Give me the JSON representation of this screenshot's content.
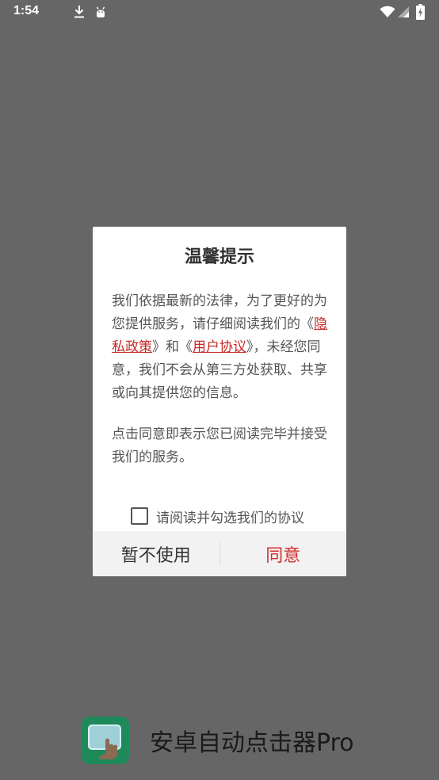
{
  "status_bar": {
    "time": "1:54"
  },
  "dialog": {
    "title": "温馨提示",
    "paragraph1": {
      "text_before": "我们依据最新的法律，为了更好的为您提供服务，请仔细阅读我们的《",
      "privacy_link": "隐私政策",
      "text_middle": "》和《",
      "user_agreement_link": "用户协议",
      "text_after": "》，未经您同意，我们不会从第三方处获取、共享或向其提供您的信息。"
    },
    "paragraph2": "点击同意即表示您已阅读完毕并接受我们的服务。",
    "agree_checkbox": {
      "label": "请阅读并勾选我们的协议",
      "checked": false
    },
    "buttons": {
      "decline": "暂不使用",
      "agree": "同意"
    }
  },
  "app": {
    "name": "安卓自动点击器Pro"
  },
  "colors": {
    "background": "#666666",
    "link": "#c62828",
    "agree_button": "#d32f2f",
    "button_bar": "#f2f2f2",
    "logo_green": "#1e8a5a"
  }
}
